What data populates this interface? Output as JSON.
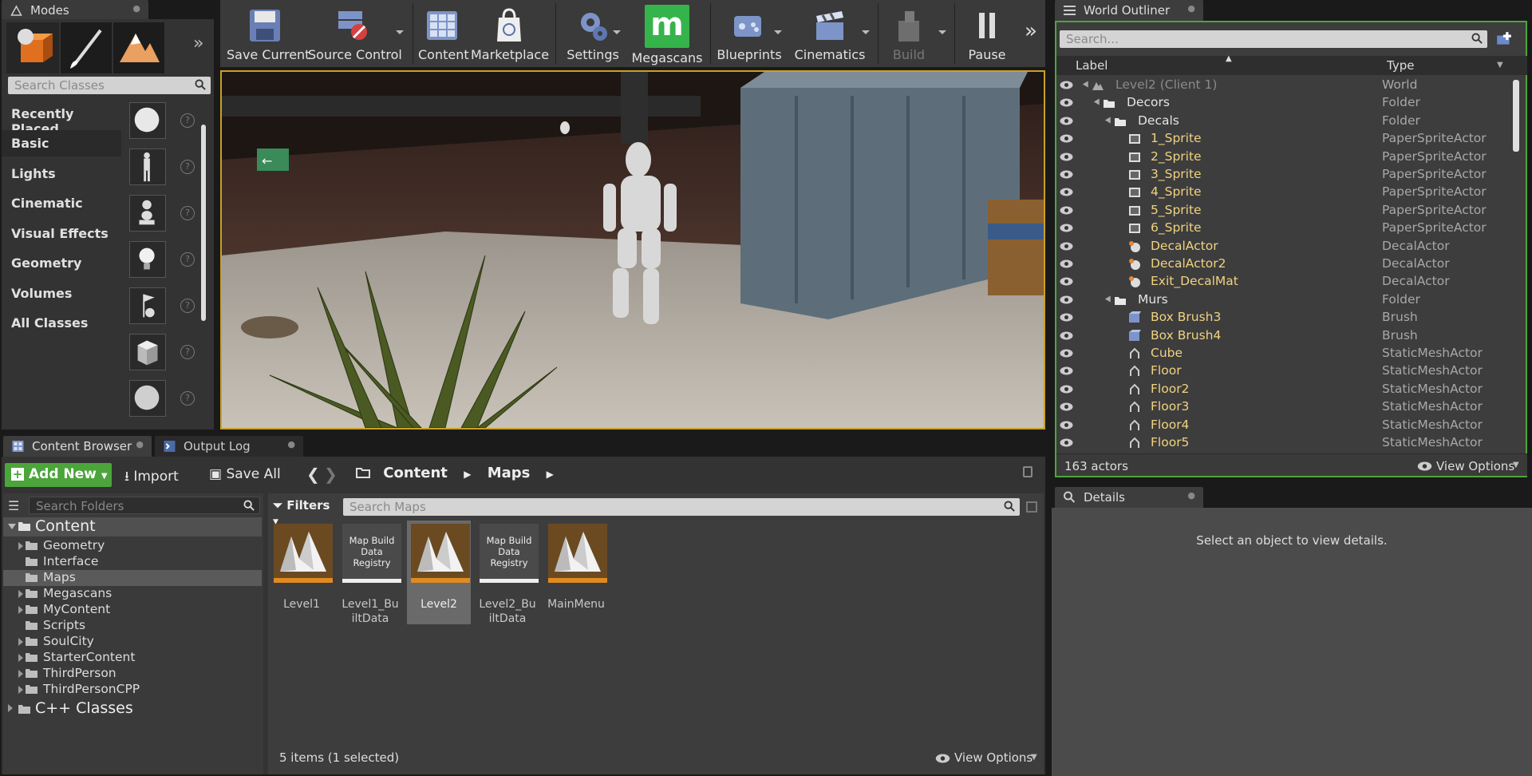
{
  "modes": {
    "tab_title": "Modes",
    "search_placeholder": "Search Classes",
    "categories": [
      "Recently Placed",
      "Basic",
      "Lights",
      "Cinematic",
      "Visual Effects",
      "Geometry",
      "Volumes",
      "All Classes"
    ],
    "selected_category": "Basic"
  },
  "toolbar": {
    "buttons": [
      {
        "label": "Save Current",
        "icon": "save-icon"
      },
      {
        "label": "Source Control",
        "icon": "source-control-icon"
      },
      {
        "label": "Content",
        "icon": "content-icon"
      },
      {
        "label": "Marketplace",
        "icon": "marketplace-icon"
      },
      {
        "label": "Settings",
        "icon": "settings-icon"
      },
      {
        "label": "Megascans",
        "icon": "megascans-icon"
      },
      {
        "label": "Blueprints",
        "icon": "blueprints-icon"
      },
      {
        "label": "Cinematics",
        "icon": "cinematics-icon"
      },
      {
        "label": "Build",
        "icon": "build-icon"
      },
      {
        "label": "Pause",
        "icon": "pause-icon"
      }
    ]
  },
  "outliner": {
    "tab_title": "World Outliner",
    "search_placeholder": "Search...",
    "col_label": "Label",
    "col_type": "Type",
    "rows": [
      {
        "label": "Level2 (Client 1)",
        "type": "World"
      },
      {
        "label": "Decors",
        "type": "Folder"
      },
      {
        "label": "Decals",
        "type": "Folder"
      },
      {
        "label": "1_Sprite",
        "type": "PaperSpriteActor"
      },
      {
        "label": "2_Sprite",
        "type": "PaperSpriteActor"
      },
      {
        "label": "3_Sprite",
        "type": "PaperSpriteActor"
      },
      {
        "label": "4_Sprite",
        "type": "PaperSpriteActor"
      },
      {
        "label": "5_Sprite",
        "type": "PaperSpriteActor"
      },
      {
        "label": "6_Sprite",
        "type": "PaperSpriteActor"
      },
      {
        "label": "DecalActor",
        "type": "DecalActor"
      },
      {
        "label": "DecalActor2",
        "type": "DecalActor"
      },
      {
        "label": "Exit_DecalMat",
        "type": "DecalActor"
      },
      {
        "label": "Murs",
        "type": "Folder"
      },
      {
        "label": "Box Brush3",
        "type": "Brush"
      },
      {
        "label": "Box Brush4",
        "type": "Brush"
      },
      {
        "label": "Cube",
        "type": "StaticMeshActor"
      },
      {
        "label": "Floor",
        "type": "StaticMeshActor"
      },
      {
        "label": "Floor2",
        "type": "StaticMeshActor"
      },
      {
        "label": "Floor3",
        "type": "StaticMeshActor"
      },
      {
        "label": "Floor4",
        "type": "StaticMeshActor"
      },
      {
        "label": "Floor5",
        "type": "StaticMeshActor"
      }
    ],
    "actor_count": "163 actors",
    "view_options": "View Options"
  },
  "details": {
    "tab_title": "Details",
    "empty_text": "Select an object to view details."
  },
  "content_browser": {
    "tab_title": "Content Browser",
    "output_log_tab": "Output Log",
    "add_new": "Add New",
    "import": "Import",
    "save_all": "Save All",
    "breadcrumb": [
      "Content",
      "Maps"
    ],
    "folder_search_placeholder": "Search Folders",
    "filters": "Filters",
    "asset_search_placeholder": "Search Maps",
    "root_folder": "Content",
    "folders": [
      "Geometry",
      "Interface",
      "Maps",
      "Megascans",
      "MyContent",
      "Scripts",
      "SoulCity",
      "StarterContent",
      "ThirdPerson",
      "ThirdPersonCPP"
    ],
    "selected_folder": "Maps",
    "cpp_classes": "C++ Classes",
    "assets": [
      {
        "name": "Level1",
        "kind": "map"
      },
      {
        "name": "Level1_BuiltData",
        "kind": "registry",
        "thumb_text": "Map Build Data Registry"
      },
      {
        "name": "Level2",
        "kind": "map",
        "selected": true
      },
      {
        "name": "Level2_BuiltData",
        "kind": "registry",
        "thumb_text": "Map Build Data Registry"
      },
      {
        "name": "MainMenu",
        "kind": "map"
      }
    ],
    "status": "5 items (1 selected)",
    "view_options": "View Options"
  },
  "colors": {
    "panel_bg": "#3d3d3d",
    "accent_green": "#4ca53b",
    "viewport_border": "#c8a028",
    "folder_label": "#f0d280",
    "megascans_green": "#35b44b"
  }
}
